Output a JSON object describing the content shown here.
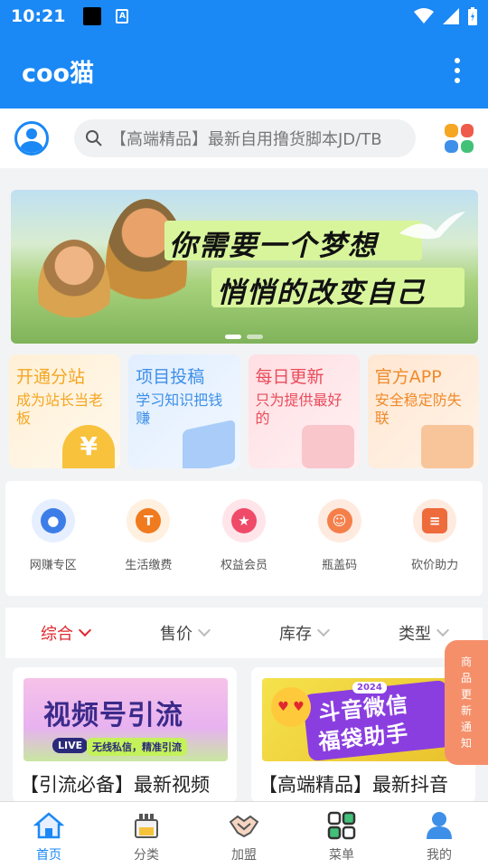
{
  "status": {
    "time": "10:21",
    "a_icon": "A"
  },
  "app_bar": {
    "title": "coo猫",
    "more_icon": "more-vertical-icon"
  },
  "search": {
    "placeholder": "【高端精品】最新自用撸货脚本JD/TB"
  },
  "banner": {
    "line1": "你需要一个梦想",
    "line2": "悄悄的改变自己",
    "slide_count": 2,
    "active_slide": 1
  },
  "cards": [
    {
      "title": "开通分站",
      "sub": "成为站长当老板",
      "title_color": "#f5a623",
      "bg": "#fff3dc",
      "deco": "#f8c23c"
    },
    {
      "title": "项目投稿",
      "sub": "学习知识把钱赚",
      "title_color": "#3d8fe8",
      "bg": "#e3efff",
      "deco": "#a9cdf8"
    },
    {
      "title": "每日更新",
      "sub": "只为提供最好的",
      "title_color": "#ea4b5a",
      "bg": "#ffe3e6",
      "deco": "#f5a7ae"
    },
    {
      "title": "官方APP",
      "sub": "安全稳定防失联",
      "title_color": "#f08a2a",
      "bg": "#ffeddc",
      "deco": "#f8c59a"
    }
  ],
  "quick_icons": [
    {
      "label": "网赚专区",
      "icon": "planet-icon",
      "bg": "#e6efff",
      "fg": "#3d7de8"
    },
    {
      "label": "生活缴费",
      "icon": "t-coin-icon",
      "bg": "#fff0e0",
      "fg": "#f07a1e"
    },
    {
      "label": "权益会员",
      "icon": "medal-icon",
      "bg": "#ffe5ea",
      "fg": "#ef4a68"
    },
    {
      "label": "瓶盖码",
      "icon": "smile-icon",
      "bg": "#ffeadf",
      "fg": "#f57f4a"
    },
    {
      "label": "砍价助力",
      "icon": "ticket-icon",
      "bg": "#ffeadf",
      "fg": "#ee6b3c"
    }
  ],
  "filters": [
    {
      "label": "综合",
      "active": true
    },
    {
      "label": "售价",
      "active": false
    },
    {
      "label": "库存",
      "active": false
    },
    {
      "label": "类型",
      "active": false
    }
  ],
  "notice": {
    "chars": [
      "商",
      "品",
      "更",
      "新",
      "通",
      "知"
    ]
  },
  "products": [
    {
      "title": "【引流必备】最新视频",
      "img_text": "视频号引流",
      "img_sub": "无线私信，精准引流",
      "badge": "LIVE"
    },
    {
      "title": "【高端精品】最新抖音",
      "img_text1": "斗音微信",
      "img_text2": "福袋助手",
      "badge": "2024"
    }
  ],
  "tabs": [
    {
      "label": "首页",
      "icon": "home-icon",
      "active": true
    },
    {
      "label": "分类",
      "icon": "category-bag-icon",
      "active": false
    },
    {
      "label": "加盟",
      "icon": "handshake-icon",
      "active": false
    },
    {
      "label": "菜单",
      "icon": "grid-menu-icon",
      "active": false
    },
    {
      "label": "我的",
      "icon": "user-icon",
      "active": true
    }
  ]
}
